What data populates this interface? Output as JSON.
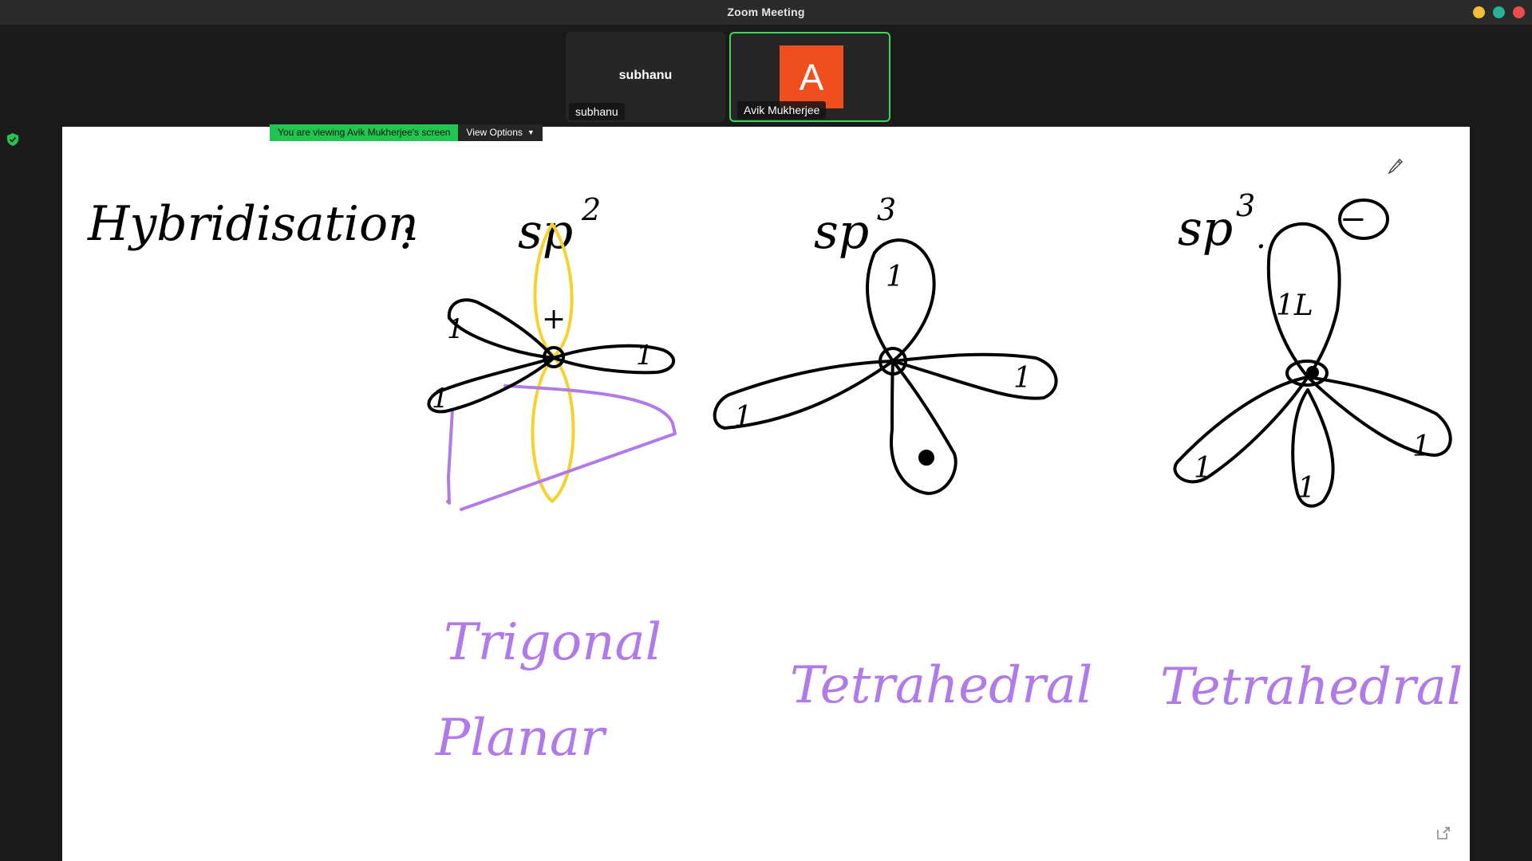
{
  "window": {
    "title": "Zoom Meeting",
    "controls": {
      "minimize_color": "#f2bf3c",
      "maximize_color": "#26b39a",
      "close_color": "#ee4c4c"
    }
  },
  "participants": [
    {
      "display_name": "subhanu",
      "label": "subhanu"
    },
    {
      "initial": "A",
      "label": "Avik Mukherjee",
      "avatar_color": "#f04e1e",
      "active_speaker_color": "#3fd55a"
    }
  ],
  "share_banner": {
    "viewing_text": "You are viewing Avik Mukherjee's screen",
    "view_options_label": "View Options",
    "banner_color": "#23c552"
  },
  "whiteboard": {
    "heading": "Hybridisation",
    "colon": ":",
    "sections": [
      {
        "base": "sp",
        "exponent": "2",
        "geometry_line1": "Trigonal",
        "geometry_line2": "Planar"
      },
      {
        "base": "sp",
        "exponent": "3",
        "geometry_line1": "Tetrahedral"
      },
      {
        "base": "sp",
        "exponent": "3",
        "suffix": ".",
        "charge": "−",
        "geometry_line1": "Tetrahedral"
      }
    ],
    "orbital_marks": {
      "sp2_p": "+",
      "sp2_hybrid": [
        "1",
        "1",
        "1"
      ],
      "sp3_a": [
        "1",
        "1",
        "1"
      ],
      "sp3_b": [
        "1L",
        "1",
        "1",
        "1"
      ]
    },
    "ink_colors": {
      "black": "#000000",
      "yellow": "#f7d12e",
      "purple": "#b07ae8"
    }
  }
}
